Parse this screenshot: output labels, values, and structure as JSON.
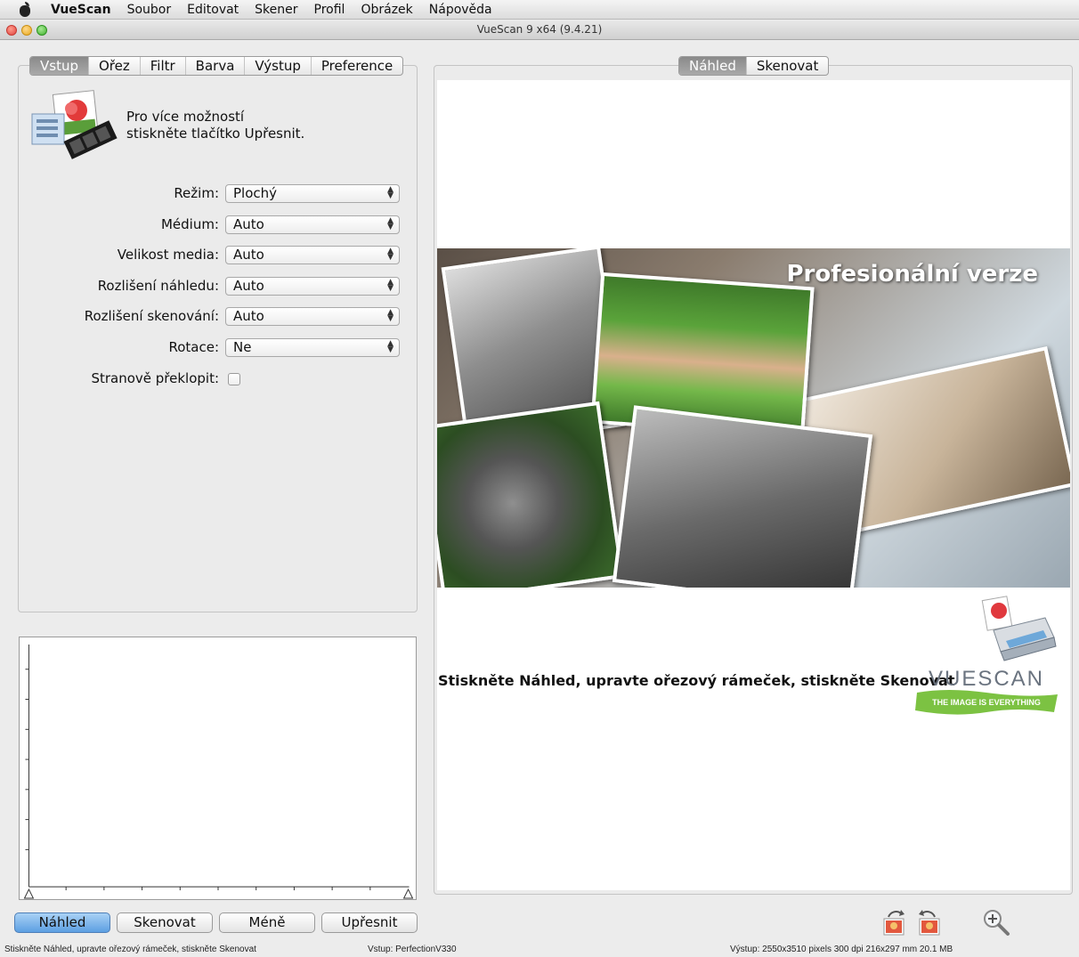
{
  "menubar": {
    "app": "VueScan",
    "items": [
      "Soubor",
      "Editovat",
      "Skener",
      "Profil",
      "Obrázek",
      "Nápověda"
    ]
  },
  "window": {
    "title": "VueScan 9 x64 (9.4.21)"
  },
  "left_tabs": [
    {
      "label": "Vstup",
      "active": true
    },
    {
      "label": "Ořez",
      "active": false
    },
    {
      "label": "Filtr",
      "active": false
    },
    {
      "label": "Barva",
      "active": false
    },
    {
      "label": "Výstup",
      "active": false
    },
    {
      "label": "Preference",
      "active": false
    }
  ],
  "info": {
    "line1": "Pro více možností",
    "line2": "stiskněte tlačítko Upřesnit."
  },
  "form": {
    "rezim": {
      "label": "Režim:",
      "value": "Plochý"
    },
    "medium": {
      "label": "Médium:",
      "value": "Auto"
    },
    "velikost": {
      "label": "Velikost media:",
      "value": "Auto"
    },
    "rozl_nahled": {
      "label": "Rozlišení náhledu:",
      "value": "Auto"
    },
    "rozl_sken": {
      "label": "Rozlišení skenování:",
      "value": "Auto"
    },
    "rotace": {
      "label": "Rotace:",
      "value": "Ne"
    },
    "preklopit": {
      "label": "Stranově překlopit:",
      "checked": false
    }
  },
  "right_tabs": [
    {
      "label": "Náhled",
      "active": true
    },
    {
      "label": "Skenovat",
      "active": false
    }
  ],
  "preview": {
    "promo_title": "Profesionální verze",
    "hint": "Stiskněte Náhled, upravte ořezový rámeček, stiskněte Skenovat",
    "logo_text": "VUESCAN",
    "logo_tagline": "THE IMAGE IS EVERYTHING"
  },
  "buttons": {
    "nahled": "Náhled",
    "skenovat": "Skenovat",
    "mene": "Méně",
    "upresnit": "Upřesnit"
  },
  "status": {
    "hint": "Stiskněte Náhled, upravte ořezový rámeček, stiskněte Skenovat",
    "input": "Vstup: PerfectionV330",
    "output": "Výstup: 2550x3510 pixels 300 dpi 216x297 mm 20.1 MB"
  },
  "colors": {
    "accent": "#5c9fe2",
    "active_tab": "#8a8a8a"
  },
  "icons": [
    "apple-icon",
    "scanner-info-icon",
    "select-arrows-icon",
    "rotate-left-icon",
    "rotate-right-icon",
    "zoom-in-icon"
  ]
}
